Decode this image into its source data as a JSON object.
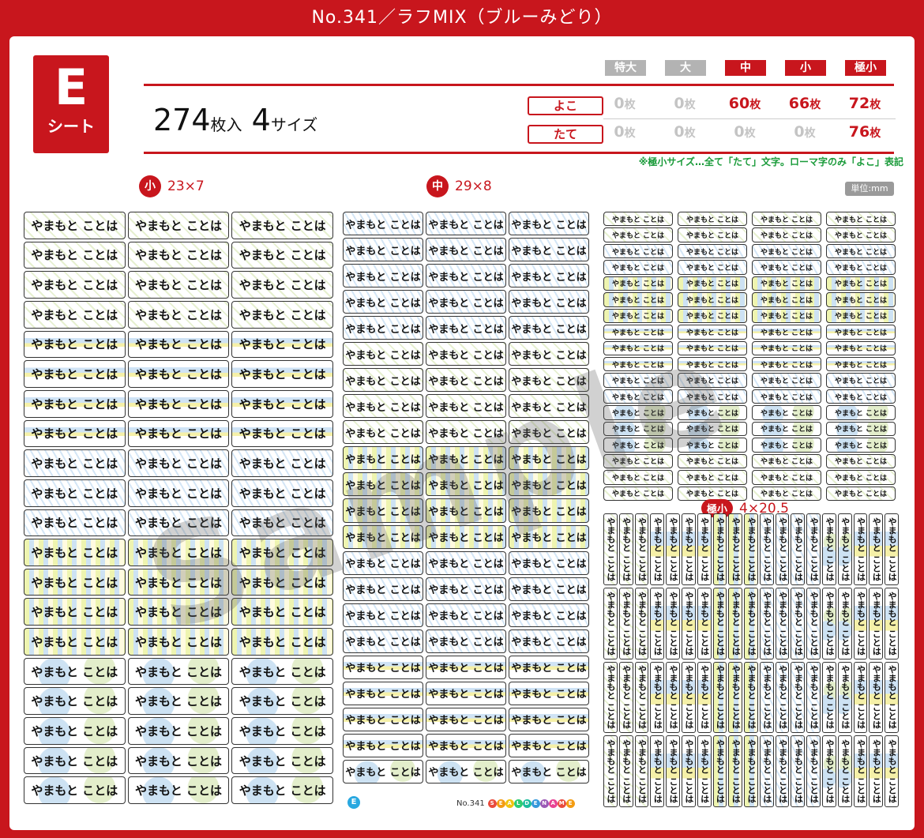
{
  "title": "No.341／ラフMIX（ブルーみどり）",
  "sheet_badge": {
    "letter": "E",
    "word": "シート"
  },
  "count": {
    "number": "274",
    "unit": "枚入",
    "sizes_num": "4",
    "sizes_unit": "サイズ"
  },
  "size_headers": [
    {
      "label": "特大",
      "color": "#b3b3b3"
    },
    {
      "label": "大",
      "color": "#b3b3b3"
    },
    {
      "label": "中",
      "color": "#c8161d"
    },
    {
      "label": "小",
      "color": "#c8161d"
    },
    {
      "label": "極小",
      "color": "#c8161d"
    }
  ],
  "directions": [
    {
      "label": "よこ",
      "values": [
        "0",
        "0",
        "60",
        "66",
        "72"
      ]
    },
    {
      "label": "たて",
      "values": [
        "0",
        "0",
        "0",
        "0",
        "76"
      ]
    }
  ],
  "qty_unit": "枚",
  "note": "※極小サイズ…全て「たて」文字。ローマ字のみ「よこ」表記",
  "unit_label": "単位:mm",
  "sections": {
    "small": {
      "badge": "小",
      "dims": "23×7"
    },
    "medium": {
      "badge": "中",
      "dims": "29×8"
    },
    "tiny": {
      "badge": "極小",
      "dims": "4×20.5"
    }
  },
  "label_text": "やまもと ことは",
  "vertical_label_text": "やまもと ことは",
  "footer": {
    "badge": "E",
    "number": "No.341",
    "brand": "SEALDENAME"
  },
  "watermark": "Sample"
}
